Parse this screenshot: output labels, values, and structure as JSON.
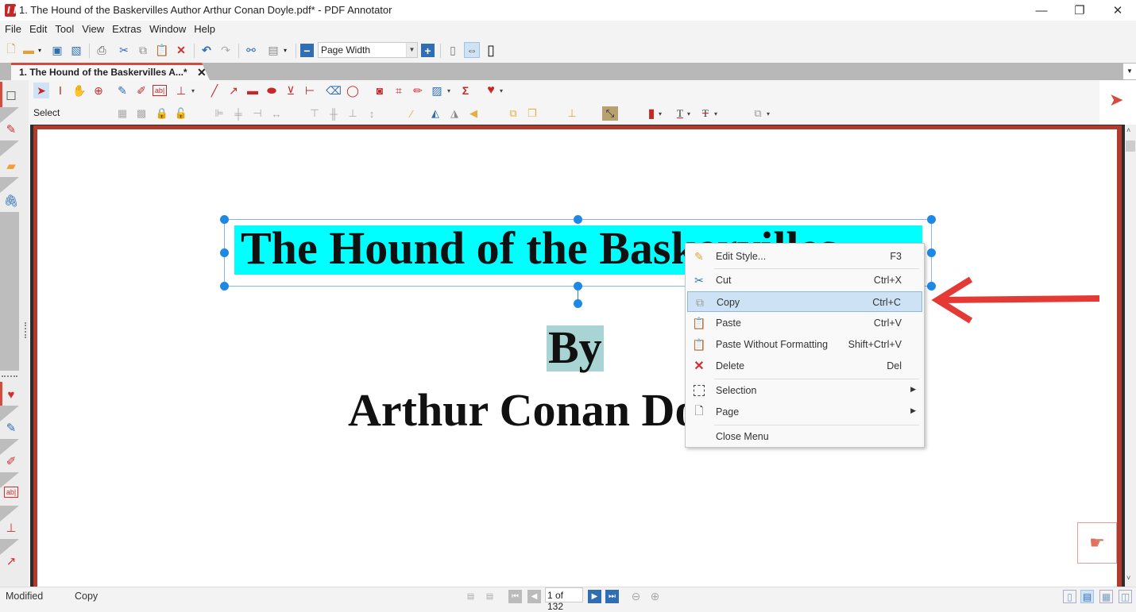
{
  "window": {
    "title": "1. The Hound of the Baskervilles Author Arthur Conan Doyle.pdf* - PDF Annotator",
    "minimize_glyph": "—",
    "restore_glyph": "❐",
    "close_glyph": "✕"
  },
  "menu": [
    "File",
    "Edit",
    "Tool",
    "View",
    "Extras",
    "Window",
    "Help"
  ],
  "toolbar": {
    "zoom_value": "Page Width",
    "icons": [
      "new-document",
      "open-folder",
      "save",
      "save-as",
      "print",
      "cut",
      "copy",
      "paste",
      "delete",
      "undo",
      "redo",
      "find",
      "page-options",
      "zoom-out",
      "zoom-in",
      "single-page",
      "fit-width",
      "full-screen"
    ]
  },
  "tab": {
    "label": "1. The Hound of the Baskervilles A...*",
    "close_glyph": "✕"
  },
  "annotation_toolbar": {
    "active_tool_label": "Select",
    "tools_row1": [
      "select",
      "text-select",
      "hand",
      "zoom",
      "pen",
      "highlighter",
      "text-box",
      "stamp",
      "line",
      "arrow",
      "rectangle",
      "ellipse",
      "polygon",
      "measure",
      "eraser",
      "lasso",
      "snapshot",
      "crop",
      "ruler",
      "insert-image",
      "equation",
      "favorites"
    ],
    "tools_row2": [
      "group",
      "ungroup",
      "lock",
      "unlock",
      "align-left",
      "align-center",
      "align-right",
      "distribute-horizontal",
      "align-top",
      "align-middle",
      "align-bottom",
      "distribute-vertical",
      "line-style",
      "flip-vertical",
      "flip-horizontal",
      "rotate",
      "bring-front",
      "send-back",
      "add-stamp",
      "line-color",
      "fill-color",
      "text-color",
      "strikeout-color",
      "copy-style"
    ]
  },
  "left_sidebar": {
    "top_items": [
      "page-thumbnail",
      "pen",
      "note",
      "attachment"
    ],
    "bottom_items": [
      "favorites",
      "pen",
      "highlighter",
      "text-box",
      "stamp",
      "arrow"
    ]
  },
  "document": {
    "title_text": "The Hound of the Baskervilles",
    "by_text": "By",
    "author_text": "Arthur Conan Doyle",
    "highlight_color": "#00ffff",
    "by_highlight_color": "#a8d4d4"
  },
  "context_menu": {
    "items": [
      {
        "label": "Edit Style...",
        "shortcut": "F3",
        "icon": "edit-style"
      },
      {
        "label": "Cut",
        "shortcut": "Ctrl+X",
        "icon": "scissors"
      },
      {
        "label": "Copy",
        "shortcut": "Ctrl+C",
        "icon": "copy",
        "highlighted": true
      },
      {
        "label": "Paste",
        "shortcut": "Ctrl+V",
        "icon": "paste"
      },
      {
        "label": "Paste Without Formatting",
        "shortcut": "Shift+Ctrl+V",
        "icon": "paste-plain"
      },
      {
        "label": "Delete",
        "shortcut": "Del",
        "icon": "delete"
      },
      {
        "label": "Selection",
        "shortcut": "",
        "icon": "selection",
        "submenu": true
      },
      {
        "label": "Page",
        "shortcut": "",
        "icon": "page",
        "submenu": true
      },
      {
        "label": "Close Menu",
        "shortcut": "",
        "icon": ""
      }
    ]
  },
  "statusbar": {
    "modified": "Modified",
    "action": "Copy",
    "page_indicator": "1 of 132"
  },
  "colors": {
    "accent_red": "#c62828",
    "selection_blue": "#1e88e5",
    "menu_highlight": "#cde3f5",
    "annotation_arrow": "#e53935"
  }
}
